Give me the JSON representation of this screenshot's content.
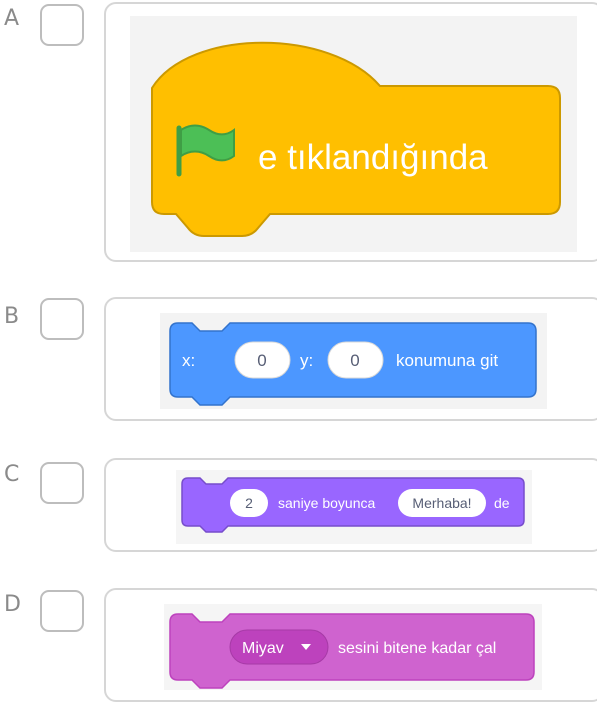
{
  "options": [
    {
      "letter": "A"
    },
    {
      "letter": "B"
    },
    {
      "letter": "C"
    },
    {
      "letter": "D"
    }
  ],
  "blocks": {
    "a": {
      "text": "e tıklandığında",
      "color": "#FFBF00",
      "flag_color": "#4CBF56"
    },
    "b": {
      "x_label": "x:",
      "x_value": "0",
      "y_label": "y:",
      "y_value": "0",
      "text": "konumuna git",
      "color": "#4C97FF"
    },
    "c": {
      "seconds": "2",
      "text": "saniye boyunca",
      "message": "Merhaba!",
      "suffix": "de",
      "color": "#9966FF"
    },
    "d": {
      "sound": "Miyav",
      "text": "sesini bitene kadar çal",
      "color": "#CF63CF"
    }
  }
}
